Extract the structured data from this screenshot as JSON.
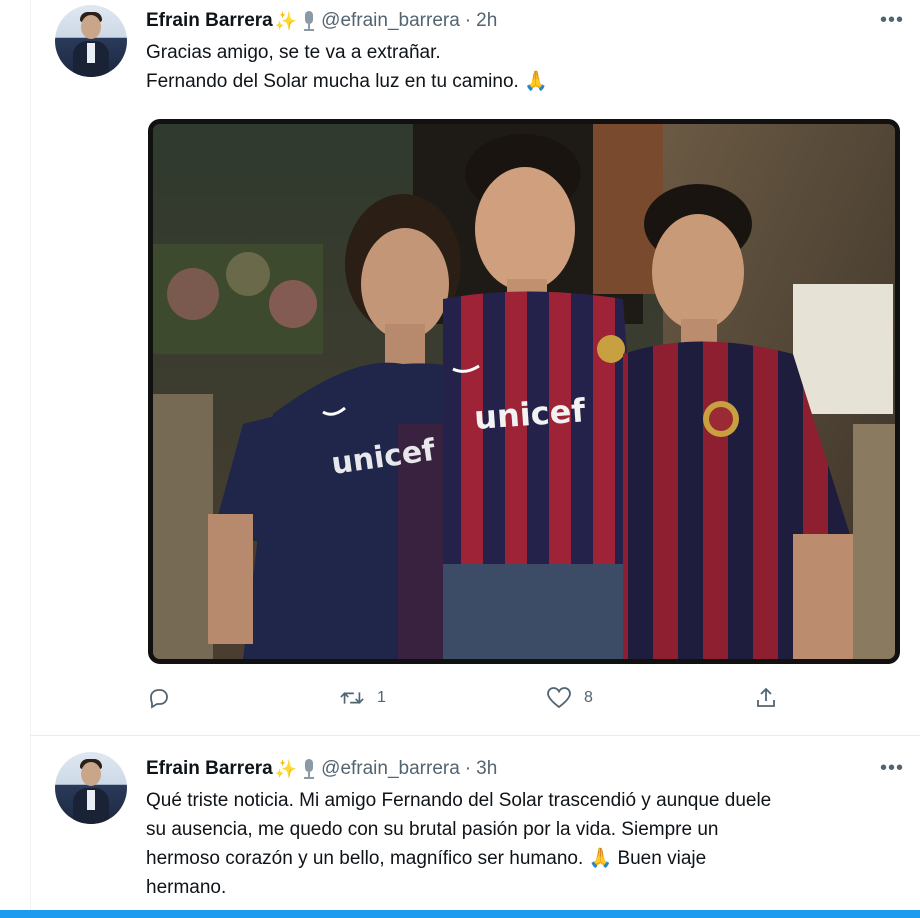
{
  "tweets": [
    {
      "author_name": "Efrain Barrera",
      "author_badge": "✨",
      "handle": "@efrain_barrera",
      "separator": "·",
      "time": "2h",
      "text_lines": [
        "Gracias amigo, se te va a extrañar.",
        "Fernando del Solar mucha luz en tu camino. 🙏"
      ],
      "media": {
        "jersey_text": "unicef"
      },
      "actions": {
        "reply_count": "",
        "retweet_count": "1",
        "like_count": "8"
      }
    },
    {
      "author_name": "Efrain Barrera",
      "author_badge": "✨",
      "handle": "@efrain_barrera",
      "separator": "·",
      "time": "3h",
      "text_lines": [
        "Qué triste noticia. Mi amigo Fernando del Solar trascendió y aunque duele",
        "su ausencia, me quedo con su brutal pasión por la vida. Siempre un",
        "hermoso corazón y un bello, magnífico ser humano. 🙏 Buen viaje",
        "hermano."
      ]
    }
  ],
  "icons": {
    "more": "more-icon",
    "reply": "reply-icon",
    "retweet": "retweet-icon",
    "like": "like-icon",
    "share": "share-icon",
    "mic": "mic-icon"
  },
  "colors": {
    "text": "#0f1419",
    "secondary": "#536471",
    "accent": "#1d9bf0",
    "divider": "#e6ecf0"
  }
}
